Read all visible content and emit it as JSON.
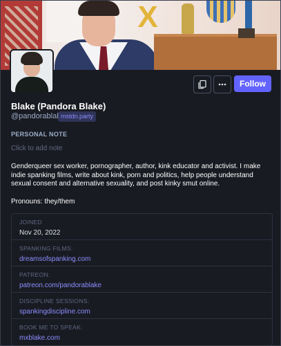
{
  "profile": {
    "display_name": "Blake (Pandora Blake)",
    "handle": "@pandorablake",
    "server": "mstdn.party",
    "follow_label": "Follow"
  },
  "personal_note": {
    "label": "PERSONAL NOTE",
    "placeholder": "Click to add note"
  },
  "bio": {
    "paragraph1": "Genderqueer sex worker, pornographer, author, kink educator and activist. I make indie spanking films, write about kink, porn and politics, help people understand sexual consent and alternative sexuality, and post kinky smut online.",
    "paragraph2": "Pronouns: they/them"
  },
  "fields": [
    {
      "key": "JOINED",
      "value": "Nov 20, 2022"
    },
    {
      "key": "SPANKING FILMS:",
      "value": "dreamsofspanking.com"
    },
    {
      "key": "PATREON:",
      "value": "patreon.com/pandorablake"
    },
    {
      "key": "DISCIPLINE SESSIONS:",
      "value": "spankingdiscipline.com"
    },
    {
      "key": "BOOK ME TO SPEAK:",
      "value": "mxblake.com"
    }
  ],
  "icons": {
    "copy": "copy-icon",
    "more": "more-icon"
  },
  "colors": {
    "background": "#191b22",
    "accent": "#6364ff",
    "link": "#8c8dff",
    "muted": "#606984"
  }
}
